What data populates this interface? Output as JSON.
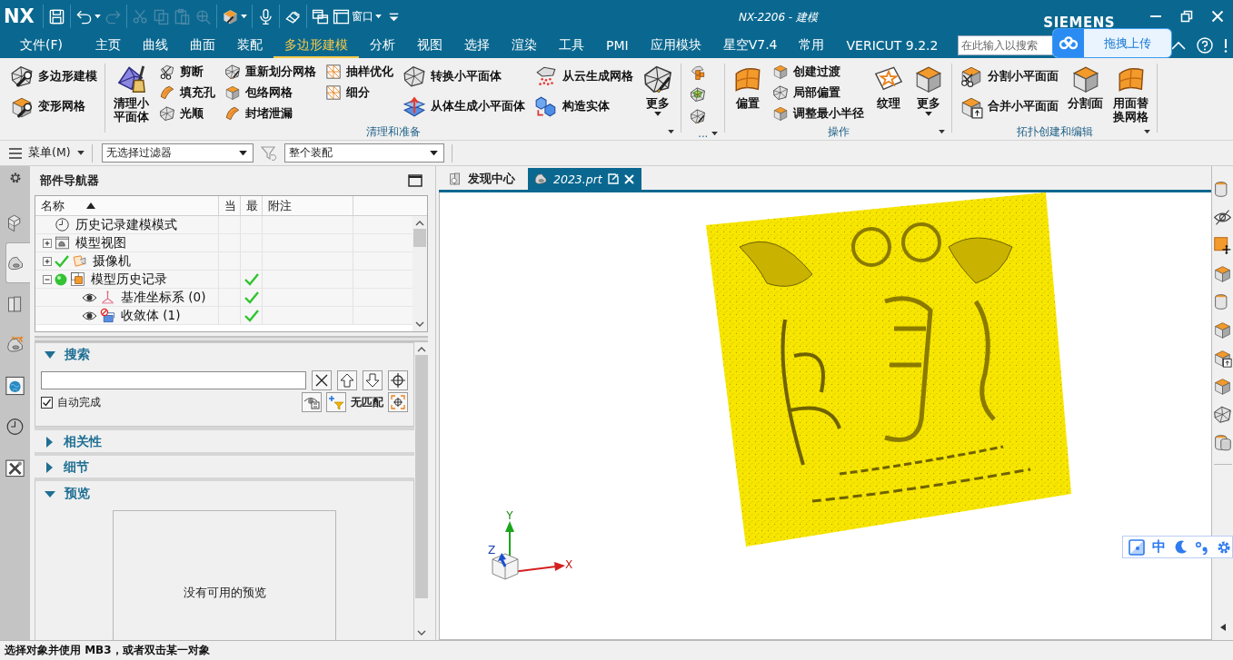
{
  "title_bar": {
    "logo": "NX",
    "title": "NX-2206 - 建模",
    "brand": "SIEMENS"
  },
  "quick_access": [
    [
      {
        "kind": "save",
        "disabled": false
      }
    ],
    [
      {
        "kind": "undo",
        "disabled": false,
        "dropdown": true
      },
      {
        "kind": "redo",
        "disabled": true
      }
    ],
    [
      {
        "kind": "cut",
        "disabled": true
      },
      {
        "kind": "copy",
        "disabled": true
      },
      {
        "kind": "paste",
        "disabled": true
      },
      {
        "kind": "transform",
        "disabled": true
      }
    ],
    [
      {
        "kind": "render",
        "disabled": false,
        "dropdown": true
      }
    ],
    [
      {
        "kind": "mic",
        "disabled": false
      }
    ],
    [
      {
        "kind": "eraser",
        "disabled": false
      }
    ],
    [
      {
        "kind": "windows",
        "disabled": false
      },
      {
        "kind": "window",
        "label": "窗口",
        "disabled": false,
        "dropdown": true
      },
      {
        "kind": "customize",
        "disabled": false
      }
    ]
  ],
  "menu_tabs": [
    {
      "label": "文件(F)",
      "selected": false
    },
    {
      "label": "主页",
      "selected": false
    },
    {
      "label": "曲线",
      "selected": false
    },
    {
      "label": "曲面",
      "selected": false
    },
    {
      "label": "装配",
      "selected": false
    },
    {
      "label": "多边形建模",
      "selected": true
    },
    {
      "label": "分析",
      "selected": false
    },
    {
      "label": "视图",
      "selected": false
    },
    {
      "label": "选择",
      "selected": false
    },
    {
      "label": "渲染",
      "selected": false
    },
    {
      "label": "工具",
      "selected": false
    },
    {
      "label": "PMI",
      "selected": false
    },
    {
      "label": "应用模块",
      "selected": false
    },
    {
      "label": "星空V7.4",
      "selected": false
    },
    {
      "label": "常用",
      "selected": false
    },
    {
      "label": "VERICUT 9.2.2",
      "selected": false
    }
  ],
  "command_search": {
    "placeholder": "在此输入以搜索"
  },
  "upload_widget": {
    "label": "拖拽上传"
  },
  "ribbon": {
    "groups": [
      {
        "columns": [
          {
            "kind": "wide",
            "items": [
              {
                "label": "多边形建模"
              },
              {
                "label": "变形网格"
              }
            ]
          }
        ]
      },
      {
        "label": "清理和准备",
        "columns": [
          {
            "kind": "large",
            "items": [
              {
                "label": "清理小平面体"
              }
            ]
          },
          {
            "kind": "stack",
            "items": [
              {
                "label": "剪断"
              },
              {
                "label": "填充孔"
              },
              {
                "label": "光顺"
              }
            ]
          },
          {
            "kind": "stack",
            "items": [
              {
                "label": "重新划分网格"
              },
              {
                "label": "包络网格"
              },
              {
                "label": "封堵泄漏"
              }
            ]
          },
          {
            "kind": "stack",
            "items": [
              {
                "label": "抽样优化"
              },
              {
                "label": "细分"
              }
            ]
          },
          {
            "kind": "wide",
            "items": [
              {
                "label": "转换小平面体"
              },
              {
                "label": "从体生成小平面体"
              }
            ]
          },
          {
            "kind": "wide",
            "items": [
              {
                "label": "从云生成网格"
              },
              {
                "label": "构造实体"
              }
            ]
          },
          {
            "kind": "large",
            "items": [
              {
                "label": "更多",
                "dropdown": true
              }
            ]
          }
        ]
      },
      {
        "label": "...",
        "columns": [
          {
            "kind": "icons"
          }
        ]
      },
      {
        "label": "操作",
        "columns": [
          {
            "kind": "large",
            "items": [
              {
                "label": "偏置"
              }
            ]
          },
          {
            "kind": "stack",
            "items": [
              {
                "label": "创建过渡"
              },
              {
                "label": "局部偏置"
              },
              {
                "label": "调整最小半径"
              }
            ]
          },
          {
            "kind": "large",
            "items": [
              {
                "label": "纹理"
              }
            ]
          },
          {
            "kind": "large",
            "items": [
              {
                "label": "更多",
                "dropdown": true
              }
            ]
          }
        ]
      },
      {
        "label": "拓扑创建和编辑",
        "columns": [
          {
            "kind": "wide",
            "items": [
              {
                "label": "分割小平面面"
              },
              {
                "label": "合并小平面面"
              }
            ]
          },
          {
            "kind": "large",
            "items": [
              {
                "label": "分割面"
              }
            ]
          },
          {
            "kind": "large",
            "items": [
              {
                "label": "用面替换网格"
              }
            ]
          }
        ]
      }
    ]
  },
  "selection_bar": {
    "menu": "菜单(M)",
    "type_filter": "无选择过滤器",
    "scope_filter": "整个装配"
  },
  "resource_bar": [
    {
      "kind": "settings",
      "selected": false
    },
    {
      "kind": "assembly",
      "selected": false
    },
    {
      "kind": "part",
      "selected": true
    },
    {
      "kind": "library",
      "selected": false
    },
    {
      "kind": "constraints",
      "selected": false
    },
    {
      "kind": "browser",
      "selected": false
    },
    {
      "kind": "history",
      "selected": false
    },
    {
      "kind": "roles",
      "selected": false
    }
  ],
  "navigator": {
    "title": "部件导航器",
    "columns": [
      "名称",
      "当",
      "最",
      "附注"
    ],
    "rows": [
      {
        "label": "历史记录建模模式",
        "kind": "history_mode",
        "latest": false
      },
      {
        "label": "模型视图",
        "kind": "views",
        "expanded": false,
        "latest": false
      },
      {
        "label": "摄像机",
        "kind": "camera",
        "expanded": false,
        "checked": true,
        "latest": false
      },
      {
        "label": "模型历史记录",
        "kind": "history",
        "expanded": true,
        "active": true,
        "latest": true,
        "children": [
          {
            "label": "基准坐标系 (0)",
            "kind": "datum",
            "visible": true,
            "latest": true
          },
          {
            "label": "收敛体 (1)",
            "kind": "body",
            "visible": true,
            "latest": true
          }
        ]
      }
    ],
    "search": {
      "label": "搜索",
      "expanded": true,
      "autocomplete": {
        "label": "自动完成",
        "checked": true
      },
      "result": "无匹配"
    },
    "sections": [
      {
        "label": "相关性",
        "expanded": false
      },
      {
        "label": "细节",
        "expanded": false
      },
      {
        "label": "预览",
        "expanded": true,
        "message": "没有可用的预览"
      }
    ]
  },
  "doc_tabs": [
    {
      "kind": "discovery",
      "label": "发现中心",
      "selected": false
    },
    {
      "kind": "part",
      "label": "2023.prt",
      "selected": true
    }
  ],
  "axis_triad": {
    "x": "X",
    "y": "Y",
    "z": "Z"
  },
  "ime_toolbar": {
    "mode": "中"
  },
  "status_bar": {
    "message": "选择对象并使用 MB3，或者双击某一对象"
  }
}
